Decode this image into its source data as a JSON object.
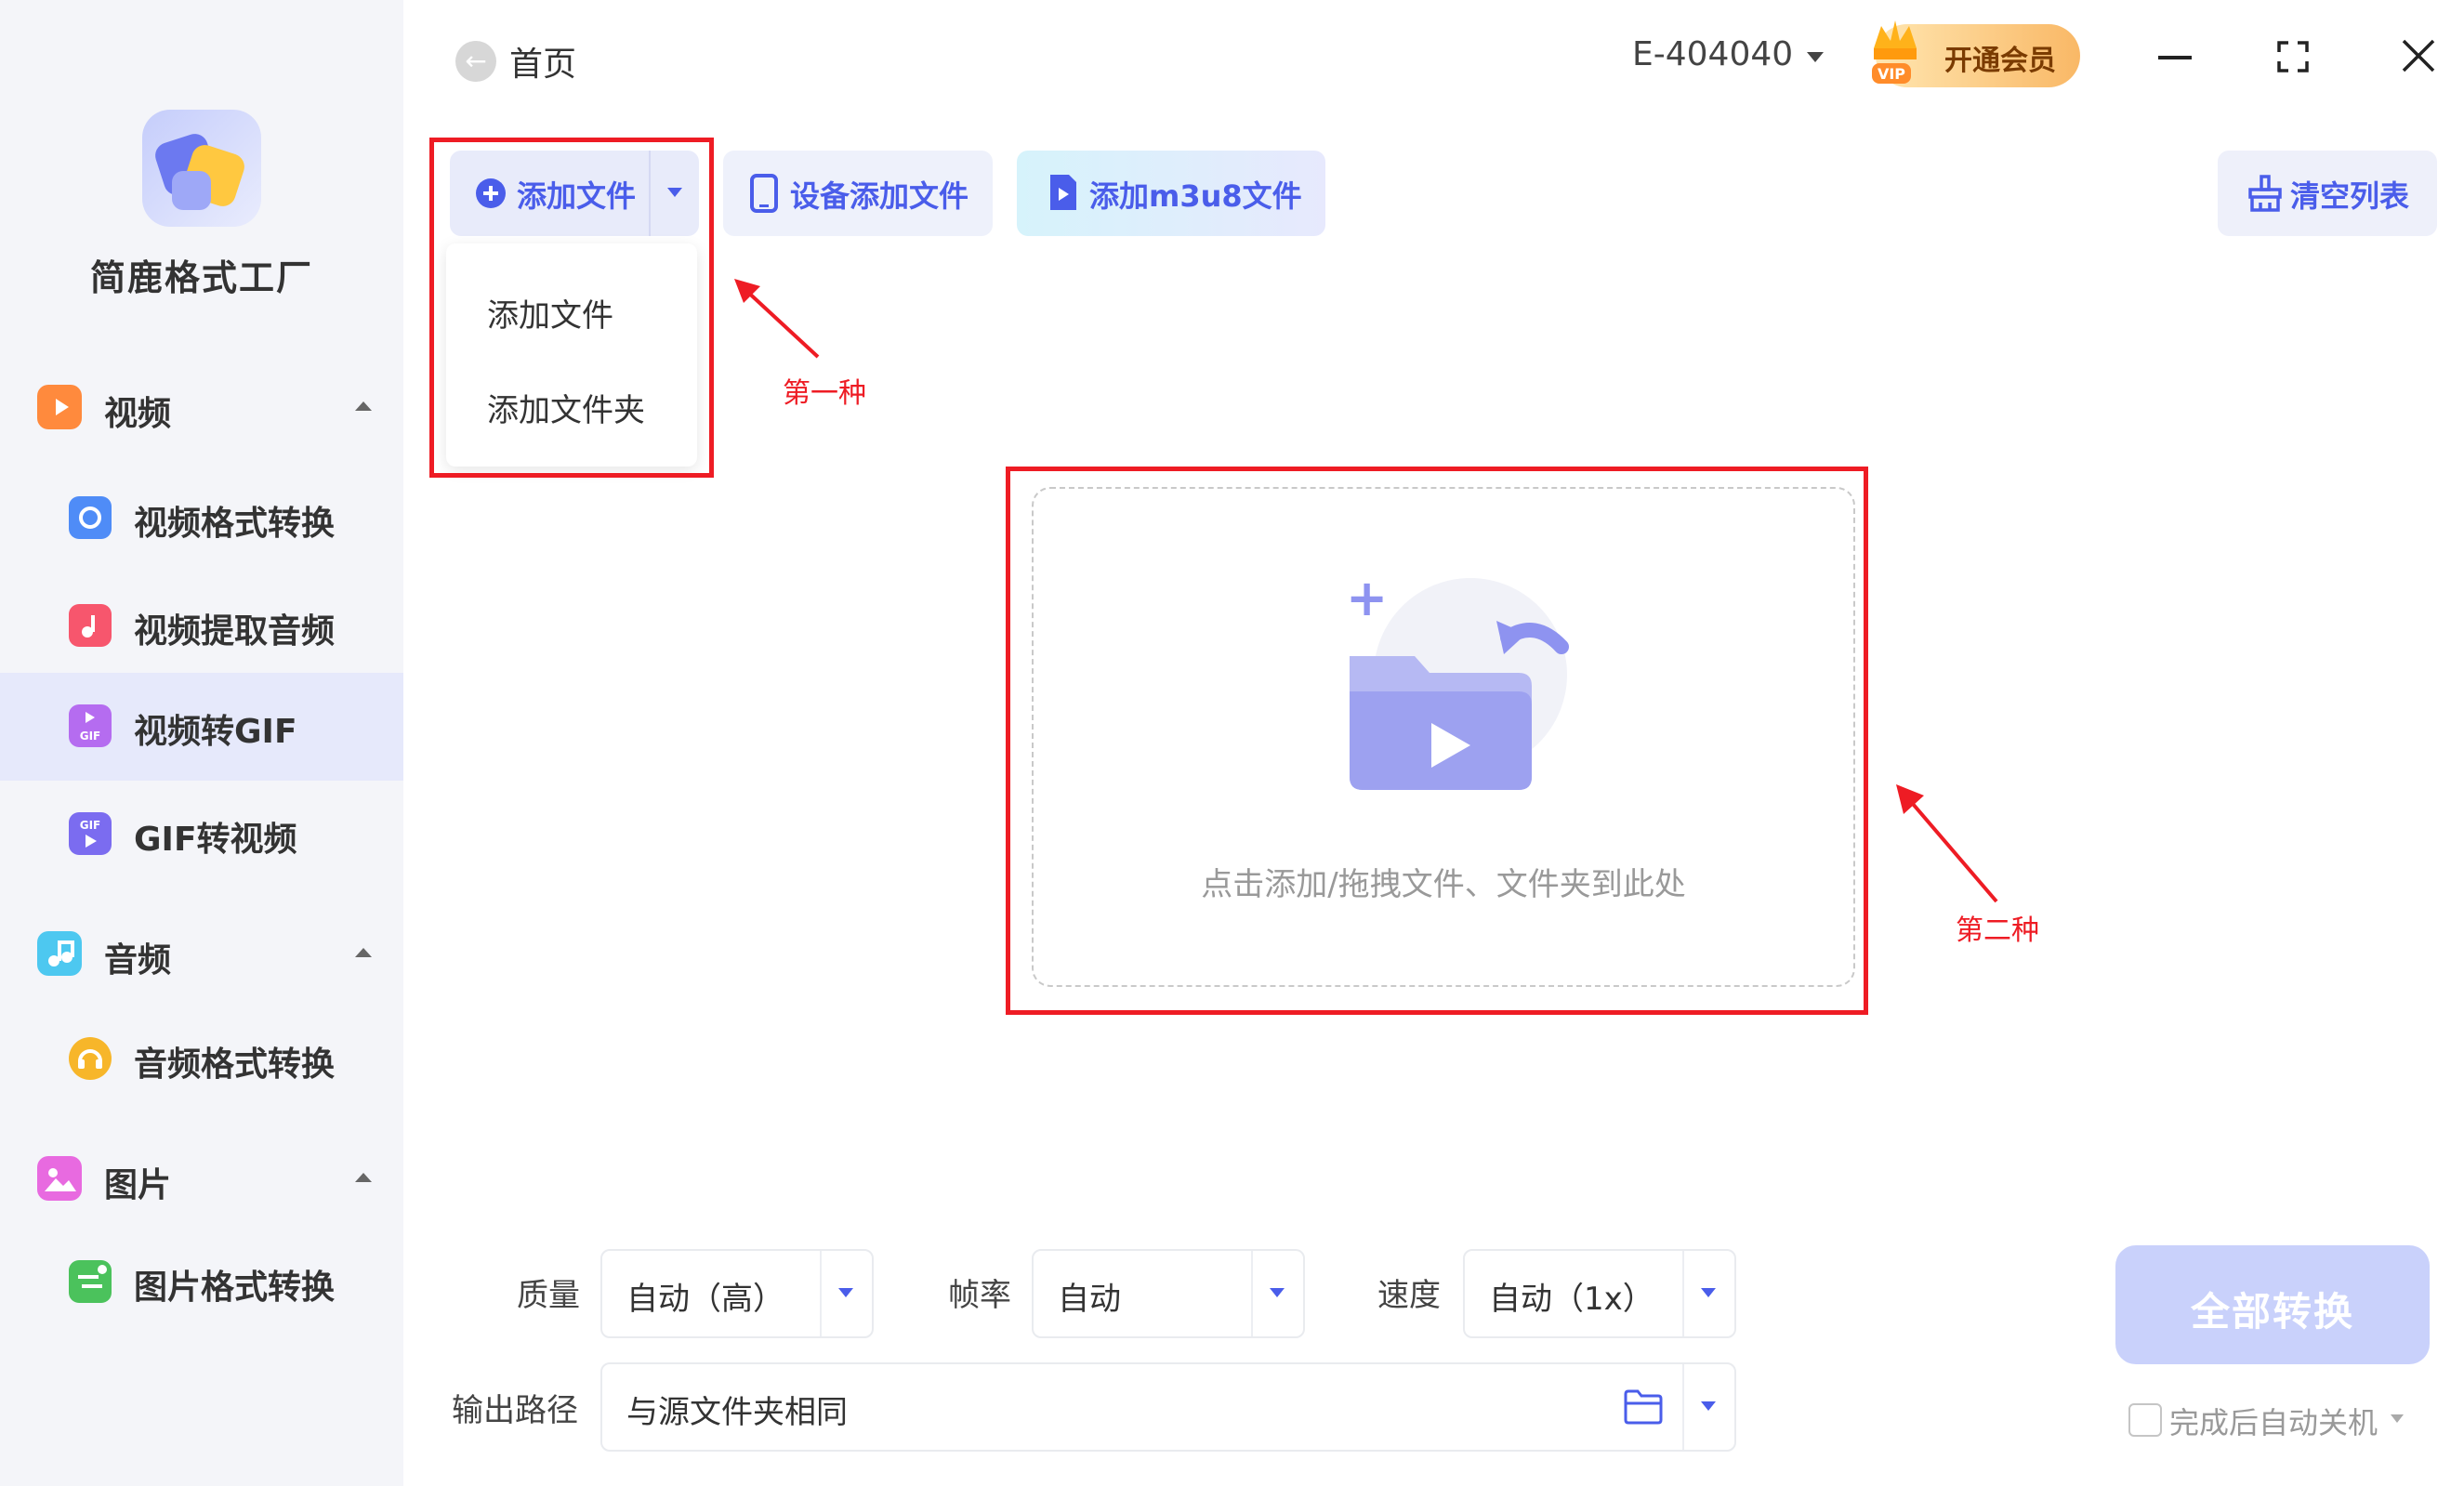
{
  "app": {
    "name": "简鹿格式工厂"
  },
  "header": {
    "back_label": "首页",
    "user_id": "E-404040",
    "vip_label": "开通会员",
    "vip_badge": "VIP"
  },
  "sidebar": {
    "categories": [
      {
        "label": "视频",
        "icon": "video-icon",
        "color": "#ff8a3d",
        "items": [
          {
            "label": "视频格式转换",
            "icon": "video-convert-icon",
            "color": "#4f8cf7"
          },
          {
            "label": "视频提取音频",
            "icon": "audio-extract-icon",
            "color": "#f7566d"
          },
          {
            "label": "视频转GIF",
            "icon": "gif-icon",
            "color": "#b56cf0",
            "active": true
          },
          {
            "label": "GIF转视频",
            "icon": "gif-video-icon",
            "color": "#7b6cf0"
          }
        ]
      },
      {
        "label": "音频",
        "icon": "music-icon",
        "color": "#4dc8f0",
        "items": [
          {
            "label": "音频格式转换",
            "icon": "audio-convert-icon",
            "color": "#f7b62a"
          }
        ]
      },
      {
        "label": "图片",
        "icon": "image-icon",
        "color": "#e86ae0",
        "items": [
          {
            "label": "图片格式转换",
            "icon": "image-convert-icon",
            "color": "#4bc25c"
          }
        ]
      }
    ]
  },
  "toolbar": {
    "add_file": "添加文件",
    "device_add": "设备添加文件",
    "add_m3u8": "添加m3u8文件",
    "clear_list": "清空列表"
  },
  "dropdown": {
    "items": [
      "添加文件",
      "添加文件夹"
    ]
  },
  "annotations": {
    "first": "第一种",
    "second": "第二种"
  },
  "dropzone": {
    "hint": "点击添加/拖拽文件、文件夹到此处"
  },
  "settings": {
    "quality_label": "质量",
    "quality_value": "自动（高）",
    "fps_label": "帧率",
    "fps_value": "自动",
    "speed_label": "速度",
    "speed_value": "自动（1x）",
    "output_label": "输出路径",
    "output_value": "与源文件夹相同"
  },
  "actions": {
    "convert_all": "全部转换",
    "auto_shutdown": "完成后自动关机"
  },
  "colors": {
    "accent": "#4a5dea",
    "annotation": "#ee1c24"
  }
}
